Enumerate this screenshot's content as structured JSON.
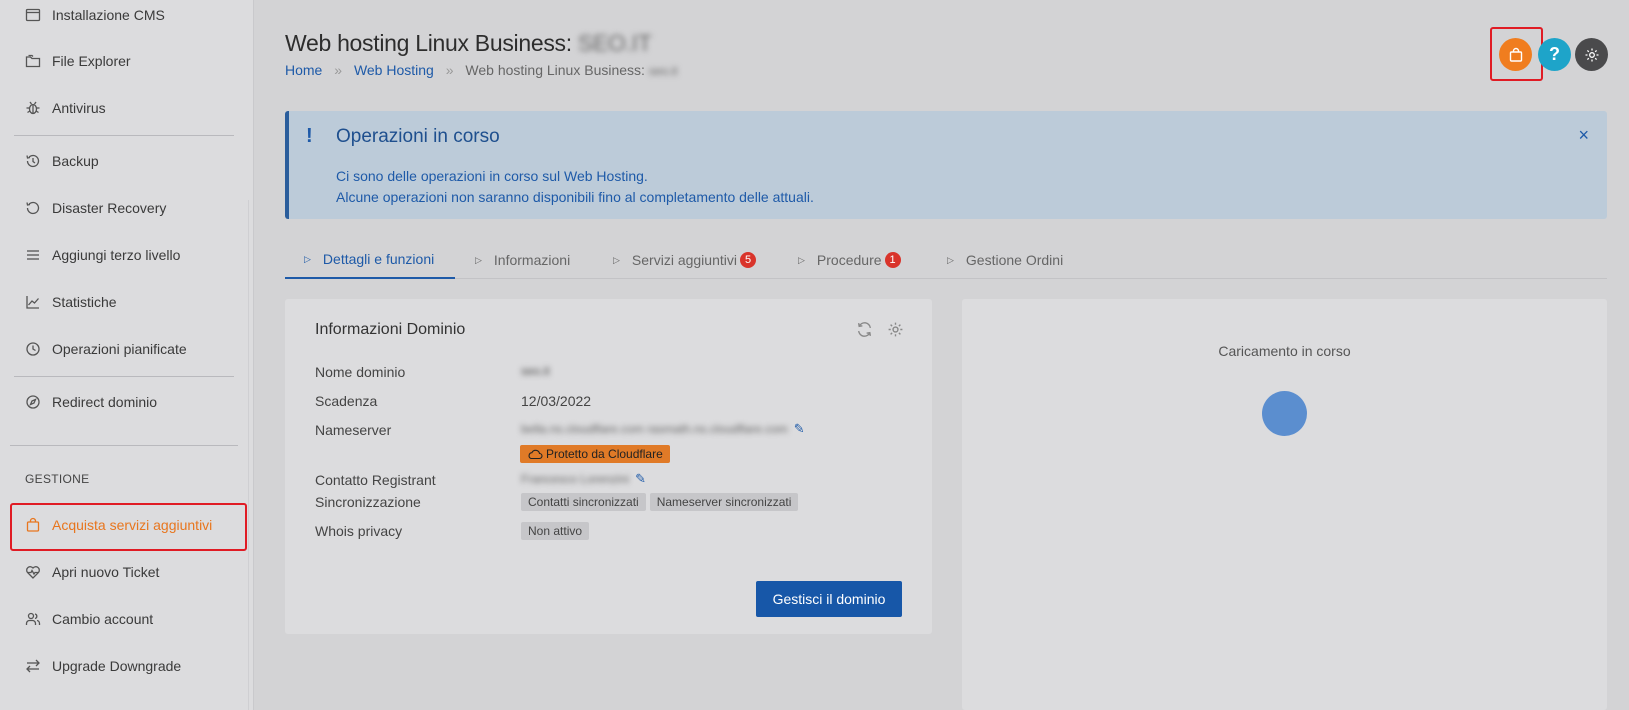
{
  "sidebar": {
    "items": [
      {
        "label": "Installazione CMS",
        "icon": "window-icon"
      },
      {
        "label": "File Explorer",
        "icon": "folders-icon"
      },
      {
        "label": "Antivirus",
        "icon": "bug-icon"
      },
      {
        "label": "Backup",
        "icon": "history-icon"
      },
      {
        "label": "Disaster Recovery",
        "icon": "rotate-icon"
      },
      {
        "label": "Aggiungi terzo livello",
        "icon": "lines-icon"
      },
      {
        "label": "Statistiche",
        "icon": "chart-line-icon"
      },
      {
        "label": "Operazioni pianificate",
        "icon": "clock-icon"
      },
      {
        "label": "Redirect dominio",
        "icon": "compass-icon"
      }
    ],
    "section_label": "GESTIONE",
    "gestione_items": [
      {
        "label": "Acquista servizi aggiuntivi",
        "icon": "shopping-bag-icon",
        "active": true
      },
      {
        "label": "Apri nuovo Ticket",
        "icon": "heartbeat-icon"
      },
      {
        "label": "Cambio account",
        "icon": "users-icon"
      },
      {
        "label": "Upgrade Downgrade",
        "icon": "swap-arrows-icon"
      }
    ]
  },
  "header": {
    "title": "Web hosting Linux Business:",
    "title_redacted": "SEO.IT",
    "breadcrumb": {
      "home": "Home",
      "sep": "»",
      "web_hosting": "Web Hosting",
      "current": "Web hosting Linux Business:",
      "current_redacted": "seo.it"
    },
    "buttons": {
      "shop_icon": "shopping-bag-icon",
      "help_label": "?",
      "settings_icon": "gear-icon"
    }
  },
  "alert": {
    "title": "Operazioni in corso",
    "line1": "Ci sono delle operazioni in corso sul Web Hosting.",
    "line2": "Alcune operazioni non saranno disponibili fino al completamento delle attuali.",
    "close": "×",
    "icon": "exclamation-icon"
  },
  "tabs": [
    {
      "label": "Dettagli e funzioni",
      "active": true
    },
    {
      "label": "Informazioni"
    },
    {
      "label": "Servizi aggiuntivi",
      "badge": "5"
    },
    {
      "label": "Procedure",
      "badge": "1"
    },
    {
      "label": "Gestione Ordini"
    }
  ],
  "domain_card": {
    "title": "Informazioni Dominio",
    "rows": {
      "nome_dominio": {
        "label": "Nome dominio",
        "value": "seo.it"
      },
      "scadenza": {
        "label": "Scadenza",
        "value": "12/03/2022"
      },
      "nameserver": {
        "label": "Nameserver",
        "value": "bella.ns.cloudflare.com rasmath.ns.cloudflare.com"
      },
      "cloudflare_badge": "Protetto da Cloudflare",
      "contatto": {
        "label": "Contatto Registrant",
        "value": "Francesco Lorenzini"
      },
      "sincronizzazione": {
        "label": "Sincronizzazione",
        "chip1": "Contatti sincronizzati",
        "chip2": "Nameserver sincronizzati"
      },
      "whois": {
        "label": "Whois privacy",
        "chip": "Non attivo"
      }
    },
    "button": "Gestisci il dominio"
  },
  "right_card": {
    "loading_text": "Caricamento in corso"
  },
  "colors": {
    "accent": "#1e5aa8",
    "orange": "#e8761e",
    "highlight": "#e01b24",
    "help": "#1ea4c9"
  }
}
